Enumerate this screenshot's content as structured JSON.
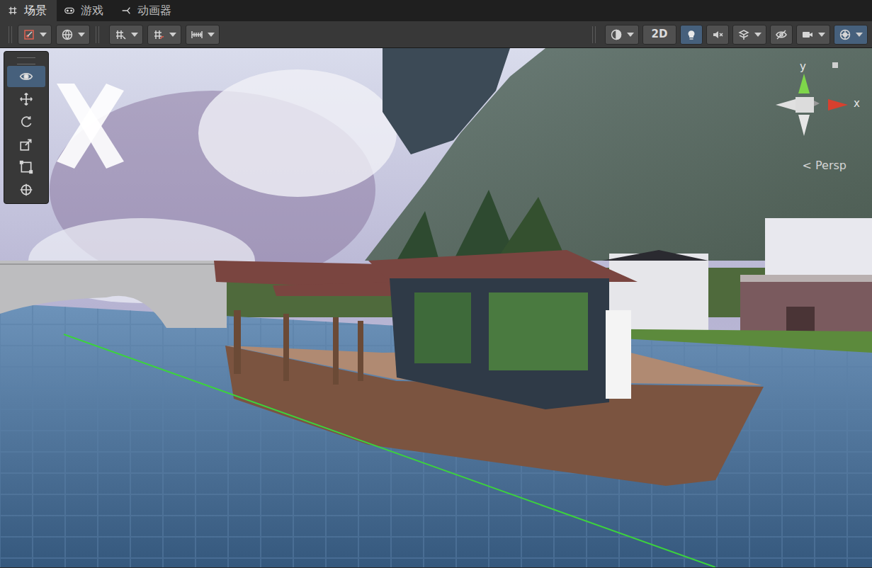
{
  "tabs": [
    {
      "label": "场景",
      "selected": true
    },
    {
      "label": "游戏",
      "selected": false
    },
    {
      "label": "动画器",
      "selected": false
    }
  ],
  "toolbar": {
    "left": [
      {
        "kind": "icon",
        "menu": true,
        "selected": false
      },
      {
        "kind": "icon",
        "menu": true,
        "selected": false
      },
      {
        "kind": "icon",
        "menu": true,
        "selected": false
      },
      {
        "kind": "icon",
        "menu": true,
        "selected": false
      },
      {
        "kind": "icon",
        "menu": true,
        "selected": false
      }
    ],
    "right": [
      {
        "kind": "icon",
        "menu": true,
        "selected": false
      },
      {
        "kind": "text",
        "label": "2D",
        "menu": false,
        "selected": false
      },
      {
        "kind": "icon",
        "menu": false,
        "selected": true
      },
      {
        "kind": "icon",
        "menu": false,
        "selected": false
      },
      {
        "kind": "icon",
        "menu": true,
        "selected": false
      },
      {
        "kind": "icon",
        "menu": false,
        "selected": false
      },
      {
        "kind": "icon",
        "menu": true,
        "selected": false
      },
      {
        "kind": "icon",
        "menu": true,
        "selected": true
      }
    ]
  },
  "tools": [
    {
      "selected": true
    },
    {
      "selected": false
    },
    {
      "selected": false
    },
    {
      "selected": false
    },
    {
      "selected": false
    },
    {
      "selected": false
    }
  ],
  "gizmo": {
    "axes": [
      {
        "label": "y"
      },
      {
        "label": "x"
      }
    ],
    "projection": "< Persp"
  }
}
